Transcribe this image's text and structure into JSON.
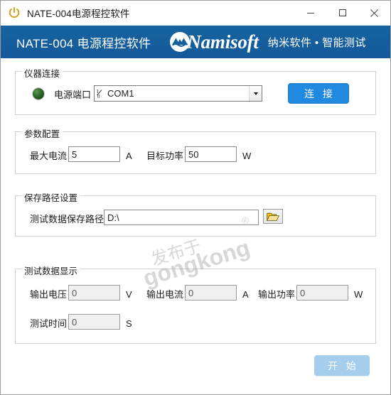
{
  "window": {
    "title": "NATE-004电源程控软件",
    "icon": "power-icon",
    "controls": {
      "minimize": "—",
      "maximize": "□",
      "close": "×"
    }
  },
  "banner": {
    "title": "NATE-004 电源程控软件",
    "logo_word": "Namisoft",
    "logo_icon": "namisoft-circle-logo",
    "subtitle": "纳米软件  •  智能测试",
    "bg_color": "#15619e"
  },
  "watermark": {
    "line1": "发布于",
    "line2": "gongkong",
    "registered": "®"
  },
  "groups": {
    "connection": {
      "legend": "仪器连接",
      "led_status": "off",
      "port_label": "电源端口",
      "port_value": "COM1",
      "port_icon": "io-icon",
      "connect_button": "连 接"
    },
    "parameters": {
      "legend": "参数配置",
      "fields": [
        {
          "label": "最大电流",
          "value": "5",
          "unit": "A"
        },
        {
          "label": "目标功率",
          "value": "50",
          "unit": "W"
        }
      ]
    },
    "savepath": {
      "legend": "保存路径设置",
      "path_label": "测试数据保存路径",
      "path_value": "D:\\",
      "browse_icon": "folder-open-icon"
    },
    "testdata": {
      "legend": "测试数据显示",
      "fields": [
        {
          "label": "输出电压",
          "value": "0",
          "unit": "V"
        },
        {
          "label": "输出电流",
          "value": "0",
          "unit": "A"
        },
        {
          "label": "输出功率",
          "value": "0",
          "unit": "W"
        },
        {
          "label": "测试时间",
          "value": "0",
          "unit": "S"
        }
      ]
    }
  },
  "footer": {
    "start_button": "开 始",
    "start_enabled": false
  },
  "colors": {
    "banner": "#15619e",
    "primary_button": "#2089e0",
    "disabled_button": "#a5cdee",
    "led_green": "#2f6b2b",
    "title_icon": "#d4a017"
  }
}
